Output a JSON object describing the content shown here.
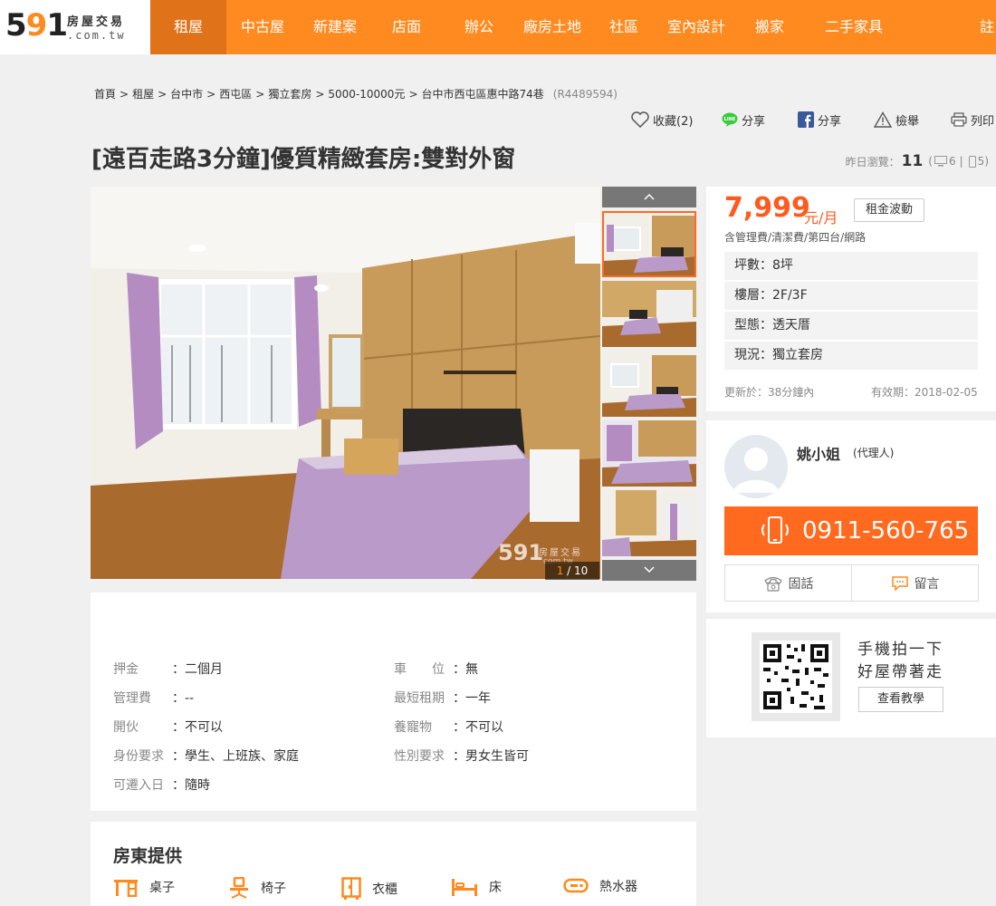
{
  "logo": {
    "number": "591",
    "title": "房屋交易",
    "domain": ".com.tw"
  },
  "nav": {
    "items": [
      "租屋",
      "中古屋",
      "新建案",
      "店面",
      "辦公",
      "廠房土地",
      "社區",
      "室內設計",
      "搬家",
      "二手家具",
      "註"
    ],
    "active": 0
  },
  "breadcrumb": {
    "items": [
      "首頁",
      "租屋",
      "台中市",
      "西屯區",
      "獨立套房",
      "5000-10000元",
      "台中市西屯區惠中路74巷"
    ],
    "code": "(R4489594)"
  },
  "actions": {
    "favorite": "收藏(2)",
    "line_share": "分享",
    "fb_share": "分享",
    "report": "檢舉",
    "print": "列印"
  },
  "listing": {
    "title": "[遠百走路3分鐘]優質精緻套房:雙對外窗",
    "views_label": "昨日瀏覽：",
    "views_total": "11",
    "views_pc": "6",
    "views_mobile": "5"
  },
  "gallery": {
    "current": "1",
    "total": "/ 10",
    "watermark_num": "591",
    "watermark_text": "房屋交易",
    "watermark_domain": "com.tw"
  },
  "price": {
    "amount": "7,999",
    "unit": "元/月",
    "trend_button": "租金波動",
    "includes": "含管理費/清潔費/第四台/網路",
    "attributes": [
      {
        "label": "坪數：",
        "value": "8坪"
      },
      {
        "label": "樓層：",
        "value": "2F/3F"
      },
      {
        "label": "型態：",
        "value": "透天厝"
      },
      {
        "label": "現況：",
        "value": "獨立套房"
      }
    ],
    "updated": "更新於：38分鐘內",
    "valid": "有效期：2018-02-05"
  },
  "agent": {
    "name": "姚小姐",
    "role": "(代理人)",
    "phone": "0911-560-765",
    "landline": "固話",
    "message": "留言"
  },
  "qr": {
    "line1": "手機拍一下",
    "line2": "好屋帶著走",
    "button": "查看教學"
  },
  "details": {
    "left": [
      {
        "label": "押金",
        "sep": "：",
        "value": "二個月"
      },
      {
        "label": "管理費",
        "sep": "：",
        "value": "--"
      },
      {
        "label": "開伙",
        "sep": "：",
        "value": "不可以"
      },
      {
        "label": "身份要求",
        "sep": "：",
        "value": "學生、上班族、家庭"
      },
      {
        "label": "可遷入日",
        "sep": "：",
        "value": "隨時"
      }
    ],
    "right": [
      {
        "label": "車　　位",
        "sep": "：",
        "value": "無"
      },
      {
        "label": "最短租期",
        "sep": "：",
        "value": "一年"
      },
      {
        "label": "養寵物",
        "sep": "：",
        "value": "不可以"
      },
      {
        "label": "性別要求",
        "sep": "：",
        "value": "男女生皆可"
      }
    ]
  },
  "facilities": {
    "title": "房東提供",
    "items": [
      {
        "label": "桌子",
        "icon": "desk-icon"
      },
      {
        "label": "椅子",
        "icon": "chair-icon"
      },
      {
        "label": "衣櫃",
        "icon": "wardrobe-icon"
      },
      {
        "label": "床",
        "icon": "bed-icon"
      },
      {
        "label": "熱水器",
        "icon": "water-heater-icon"
      }
    ]
  },
  "colors": {
    "brand": "#ff8a1f",
    "brand_dark": "#e0731a",
    "price": "#ff5a1f",
    "phone_button": "#ff6a1f"
  }
}
